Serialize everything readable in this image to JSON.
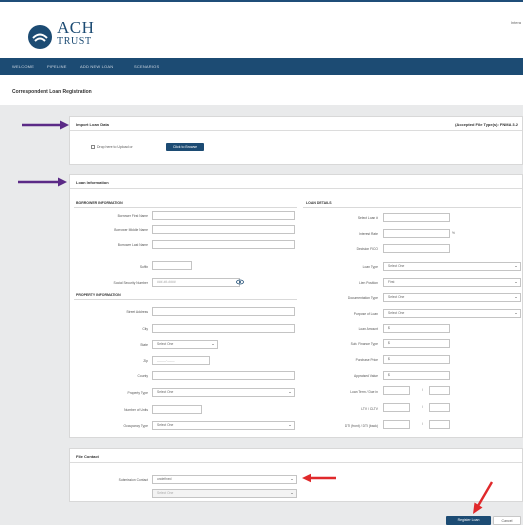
{
  "brand": {
    "line1": "ACH",
    "line2": "TRUST"
  },
  "header": {
    "right_text": "Intera"
  },
  "nav": {
    "items": [
      "WELCOME",
      "PIPELINE",
      "ADD NEW LOAN",
      "SCENARIOS"
    ]
  },
  "page": {
    "title": "Correspondent Loan Registration"
  },
  "import": {
    "title": "Import Loan Data",
    "accepted": "(Accepted File Type(s): FNMA 3.2",
    "drop_label": "Drop here to Upload or",
    "browse_label": "Click to Browse"
  },
  "loan_info": {
    "title": "Loan Information"
  },
  "borrower": {
    "title": "BORROWER INFORMATION",
    "first_name": {
      "label": "Borrower First Name",
      "value": ""
    },
    "middle_name": {
      "label": "Borrower Middle Name",
      "value": ""
    },
    "last_name": {
      "label": "Borrower Last Name",
      "value": ""
    },
    "suffix": {
      "label": "Suffix",
      "value": ""
    },
    "ssn": {
      "label": "Social Security Number",
      "placeholder": "###-##-####"
    }
  },
  "property": {
    "title": "PROPERTY INFORMATION",
    "street": {
      "label": "Street Address",
      "value": ""
    },
    "city": {
      "label": "City",
      "value": ""
    },
    "state": {
      "label": "State",
      "value": "Select One"
    },
    "zip": {
      "label": "Zip",
      "placeholder": "_____-____"
    },
    "county": {
      "label": "County",
      "value": ""
    },
    "property_type": {
      "label": "Property Type",
      "value": "Select One"
    },
    "units": {
      "label": "Number of Units",
      "value": ""
    },
    "occupancy": {
      "label": "Occupancy Type",
      "value": "Select One"
    }
  },
  "loan": {
    "title": "LOAN DETAILS",
    "select_loan": {
      "label": "Select Loan #",
      "value": ""
    },
    "interest_rate": {
      "label": "Interest Rate",
      "value": "",
      "suffix": "%"
    },
    "decision_fico": {
      "label": "Decision FICO",
      "value": ""
    },
    "loan_type": {
      "label": "Loan Type",
      "value": "Select One"
    },
    "lien_position": {
      "label": "Lien Position",
      "value": "First"
    },
    "documentation_type": {
      "label": "Documentation Type",
      "value": "Select One"
    },
    "purpose": {
      "label": "Purpose of Loan",
      "value": "Select One"
    },
    "loan_amount": {
      "label": "Loan Amount",
      "value": "$"
    },
    "sub_financing": {
      "label": "Sub. Finance Type",
      "value": "$"
    },
    "purchase_price": {
      "label": "Purchase Price",
      "value": "$"
    },
    "appraised_value": {
      "label": "Appraised Value",
      "value": "$"
    },
    "loan_term": {
      "label": "Loan Term / Due in",
      "value1": "",
      "value2": "",
      "sep": "/"
    },
    "ltv_cltv": {
      "label": "LTV / CLTV",
      "value1": "",
      "value2": "",
      "sep": "/"
    },
    "dti": {
      "label": "DTI (front) / DTI (back)",
      "value1": "",
      "value2": "",
      "sep": "/"
    }
  },
  "file_contact": {
    "title": "File Contact",
    "label": "Submission Contact",
    "value": "undefined",
    "second_value": "Select One"
  },
  "actions": {
    "submit": "Register Loan",
    "cancel": "Cancel"
  },
  "colors": {
    "brand": "#1c4b73",
    "arrow_purple": "#5b2a86",
    "arrow_red": "#e0292b"
  }
}
